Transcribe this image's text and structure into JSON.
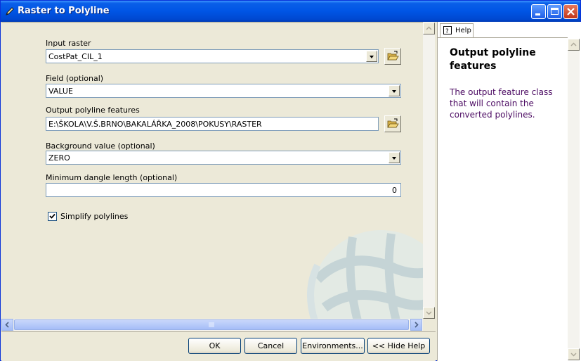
{
  "window": {
    "title": "Raster to Polyline",
    "accent": "#0055e5"
  },
  "form": {
    "input_raster": {
      "label": "Input raster",
      "value": "CostPat_CIL_1"
    },
    "field": {
      "label": "Field (optional)",
      "value": "VALUE"
    },
    "output": {
      "label": "Output polyline features",
      "value": "E:\\ŠKOLA\\V.Š.BRNO\\BAKALÁŘKA_2008\\POKUSY\\RASTER"
    },
    "background": {
      "label": "Background value (optional)",
      "value": "ZERO"
    },
    "dangle": {
      "label": "Minimum dangle length (optional)",
      "value": "0"
    },
    "simplify": {
      "label": "Simplify polylines",
      "checked": true
    }
  },
  "buttons": {
    "ok": "OK",
    "cancel": "Cancel",
    "environments": "Environments...",
    "hide_help": "<< Hide Help"
  },
  "help": {
    "tab_label": "Help",
    "heading": "Output polyline features",
    "body": "The output feature class that will contain the converted polylines.",
    "body_color": "#4b0a62"
  },
  "icons": [
    "pencil-tool-icon",
    "minimize-icon",
    "maximize-icon",
    "close-icon",
    "folder-open-icon",
    "help-icon",
    "globe-watermark"
  ]
}
